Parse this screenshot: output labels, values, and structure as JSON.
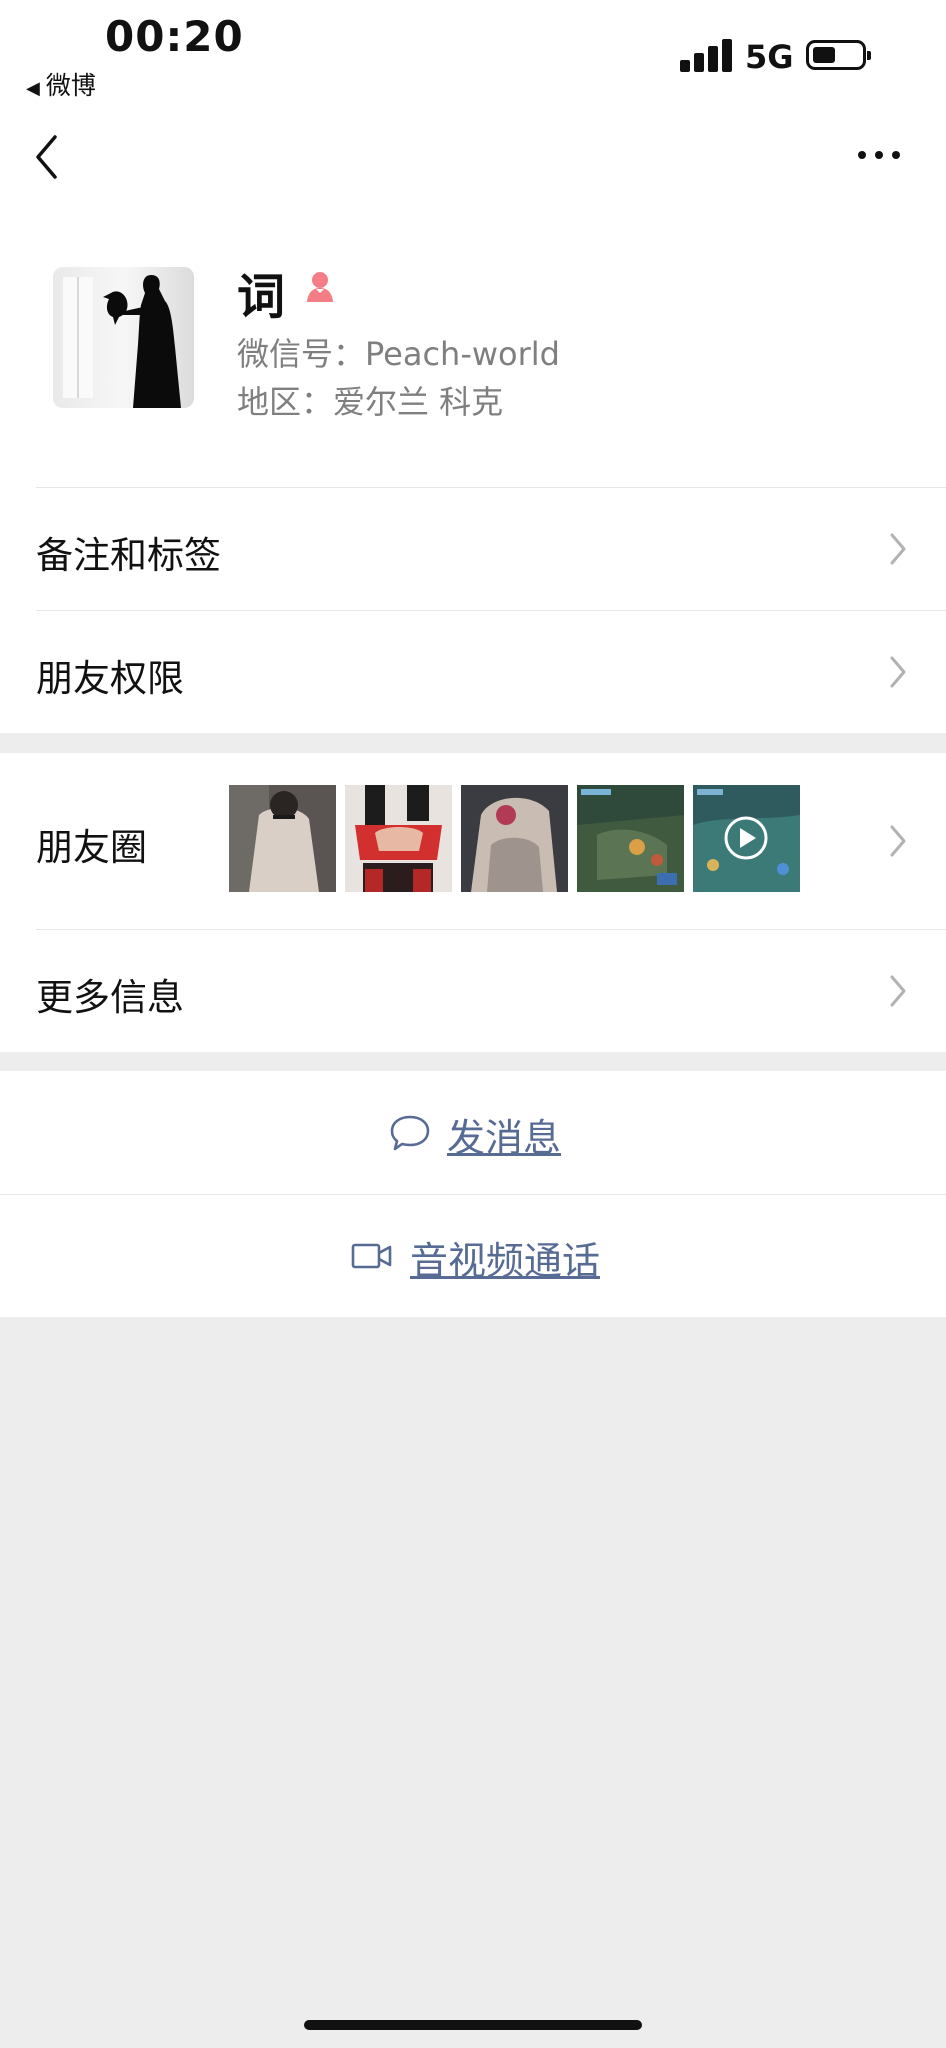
{
  "status_bar": {
    "time": "00:20",
    "back_app": "微博",
    "network": "5G"
  },
  "nav": {
    "back_icon": "chevron-left-icon",
    "more_icon": "more-dots-icon"
  },
  "profile": {
    "name": "词",
    "gender_icon": "female-icon",
    "wechat_id": "微信号：Peach-world",
    "region": "地区：爱尔兰 科克"
  },
  "rows": {
    "remarks_tags": "备注和标签",
    "friend_permissions": "朋友权限",
    "moments": "朋友圈",
    "more_info": "更多信息"
  },
  "actions": {
    "send_message": "发消息",
    "video_call": "音视频通话"
  },
  "colors": {
    "link": "#576b95",
    "background": "#ededed",
    "female_icon": "#f37e86"
  }
}
